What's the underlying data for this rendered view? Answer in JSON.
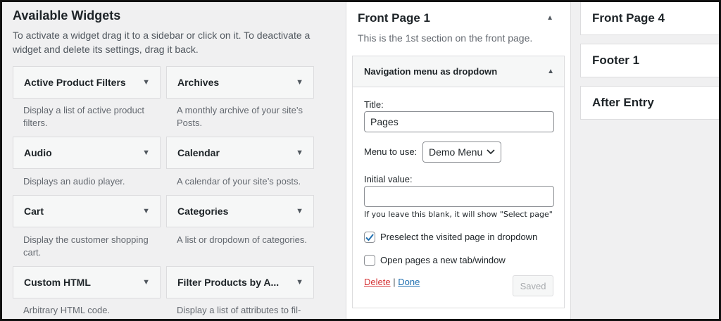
{
  "available": {
    "title": "Available Widgets",
    "description": "To activate a widget drag it to a sidebar or click on it. To deactivate a widget and delete its settings, drag it back."
  },
  "widgets": [
    {
      "name": "Active Product Filters",
      "desc": "Display a list of active product filters."
    },
    {
      "name": "Archives",
      "desc": "A monthly archive of your site’s Posts."
    },
    {
      "name": "Audio",
      "desc": "Displays an audio player."
    },
    {
      "name": "Calendar",
      "desc": "A calendar of your site’s posts."
    },
    {
      "name": "Cart",
      "desc": "Display the customer shopping cart."
    },
    {
      "name": "Categories",
      "desc": "A list or dropdown of categories."
    },
    {
      "name": "Custom HTML",
      "desc": "Arbitrary HTML code."
    },
    {
      "name": "Filter Products by A...",
      "desc": "Display a list of attributes to fil-"
    }
  ],
  "sidebar_front1": {
    "title": "Front Page 1",
    "description": "This is the 1st section on the front page."
  },
  "placed_widget": {
    "title": "Navigation menu as dropdown",
    "title_label": "Title:",
    "title_value": "Pages",
    "menu_label": "Menu to use:",
    "menu_value": "Demo Menu",
    "initial_label": "Initial value:",
    "initial_value": "",
    "hint": "If you leave this blank, it will show \"Select page\"",
    "check1_label": "Preselect the visited page in dropdown",
    "check1_checked": true,
    "check2_label": "Open pages a new tab/window",
    "check2_checked": false,
    "delete_label": "Delete",
    "separator": "|",
    "done_label": "Done",
    "saved_label": "Saved"
  },
  "right_sidebars": [
    "Front Page 4",
    "Footer 1",
    "After Entry"
  ],
  "colors": {
    "accent": "#2271b1",
    "delete": "#d63638"
  }
}
